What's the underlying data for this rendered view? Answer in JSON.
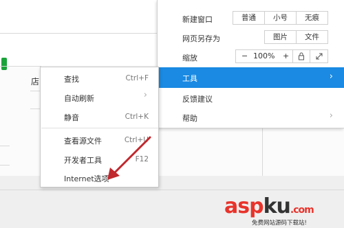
{
  "background": {
    "store_fragment": "店"
  },
  "main_menu": {
    "new_window": {
      "label": "新建窗口",
      "options": [
        "普通",
        "小号",
        "无痕"
      ]
    },
    "save_as": {
      "label": "网页另存为",
      "options": [
        "图片",
        "文件"
      ]
    },
    "zoom": {
      "label": "缩放",
      "minus": "−",
      "value": "100%",
      "plus": "+"
    },
    "tools": {
      "label": "工具",
      "highlight_color": "#1a8ae3"
    },
    "feedback": {
      "label": "反馈建议"
    },
    "help": {
      "label": "帮助"
    }
  },
  "tools_submenu": {
    "items": [
      {
        "label": "查找",
        "shortcut": "Ctrl+F"
      },
      {
        "label": "自动刷新",
        "shortcut": ""
      },
      {
        "label": "静音",
        "shortcut": "Ctrl+K"
      },
      {
        "label": "查看源文件",
        "shortcut": "Ctrl+U"
      },
      {
        "label": "开发者工具",
        "shortcut": "F12"
      },
      {
        "label": "Internet选项",
        "shortcut": ""
      }
    ]
  },
  "annotation": {
    "arrow_color": "#c0282d"
  },
  "watermark": {
    "main_a": "asp",
    "main_b": "ku",
    "main_c": ".com",
    "sub": "免费网站源码下载站!",
    "color": "#e8332b"
  }
}
